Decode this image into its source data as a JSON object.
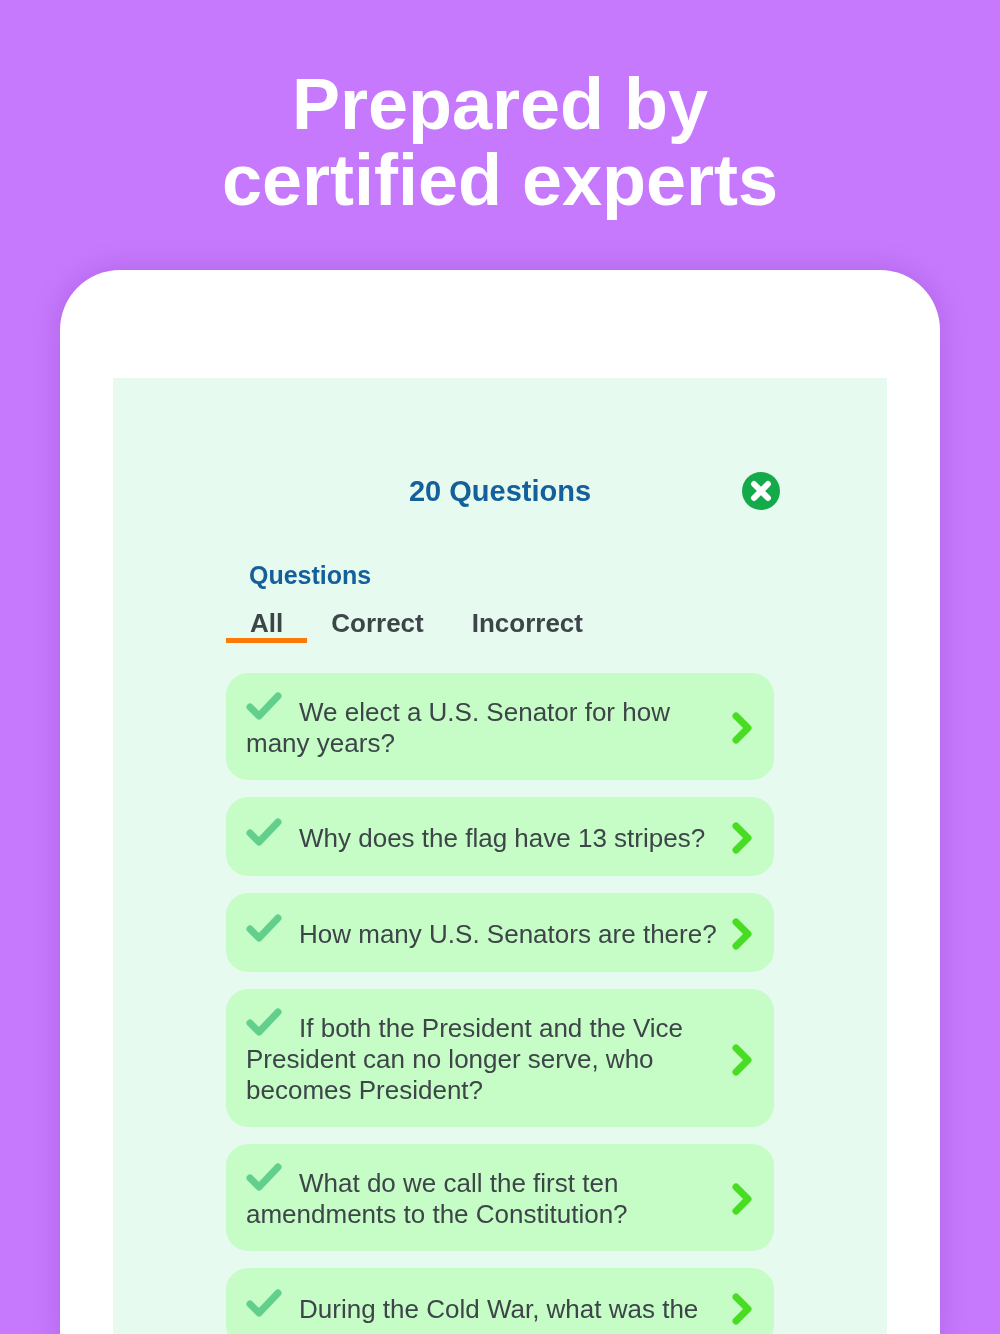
{
  "headline": "Prepared by certified experts",
  "panel": {
    "title": "20 Questions",
    "section_label": "Questions",
    "tabs": [
      {
        "label": "All",
        "selected": true
      },
      {
        "label": "Correct",
        "selected": false
      },
      {
        "label": "Incorrect",
        "selected": false
      }
    ],
    "questions": [
      {
        "text": "We elect a U.S. Senator for how many years?",
        "correct": true
      },
      {
        "text": "Why does the flag have 13 stripes?",
        "correct": true
      },
      {
        "text": "How many U.S. Senators are there?",
        "correct": true
      },
      {
        "text": "If both the President and the Vice President can no longer serve, who becomes President?",
        "correct": true
      },
      {
        "text": "What do we call the first ten amendments to the Constitution?",
        "correct": true
      },
      {
        "text": "During the Cold War, what was the",
        "correct": true
      }
    ]
  }
}
